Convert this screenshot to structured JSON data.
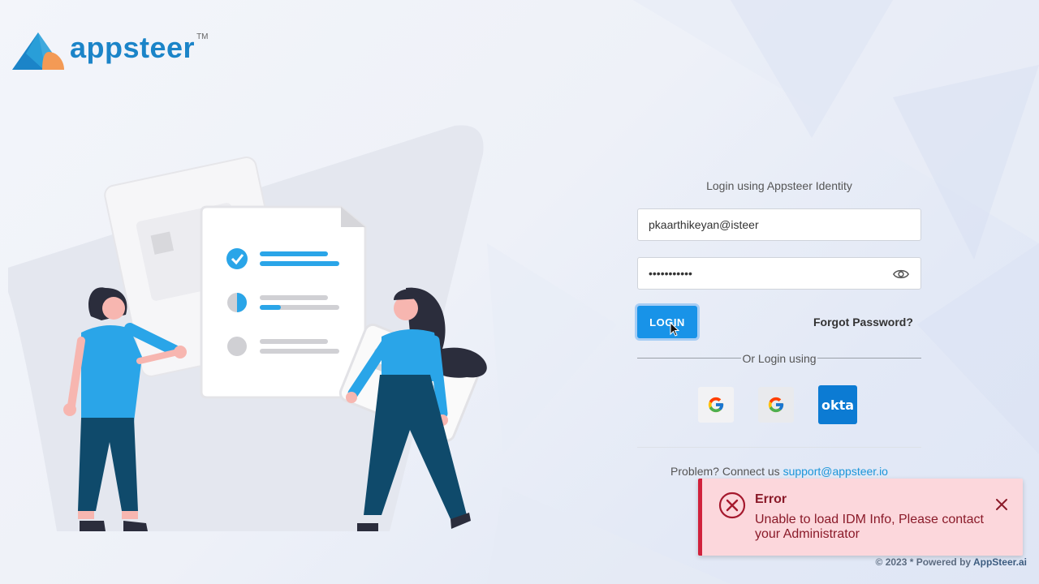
{
  "brand": {
    "name": "appsteer",
    "tm": "TM"
  },
  "login": {
    "title": "Login using Appsteer Identity",
    "email_value": "pkaarthikeyan@isteer",
    "password_mask": "•••••••••••",
    "login_label": "LOGIN",
    "forgot_label": "Forgot Password?",
    "or_label": "Or Login using"
  },
  "social": {
    "okta_label": "okta"
  },
  "support": {
    "prefix": "Problem? Connect us ",
    "email": "support@appsteer.io"
  },
  "toast": {
    "title": "Error",
    "message": "Unable to load IDM Info, Please contact your Administrator"
  },
  "footer": {
    "text": "© 2023 * Powered by ",
    "brand": "AppSteer.ai"
  },
  "colors": {
    "primary": "#1893e8",
    "error": "#d1213c",
    "okta": "#0c7bd3",
    "brand": "#1b84c8"
  }
}
